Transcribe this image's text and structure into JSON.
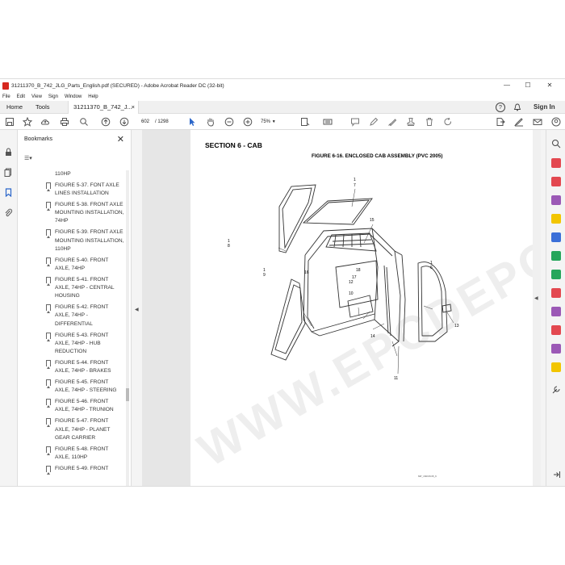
{
  "window": {
    "title": "31211370_B_742_JLG_Parts_English.pdf (SECURED) - Adobe Acrobat Reader DC (32-bit)",
    "minimize": "—",
    "maximize": "☐",
    "close": "✕"
  },
  "menu": [
    "File",
    "Edit",
    "View",
    "Sign",
    "Window",
    "Help"
  ],
  "tabs": {
    "home": "Home",
    "tools": "Tools",
    "document": "31211370_B_742_J...",
    "close": "×",
    "help": "?",
    "bell": "🔔",
    "sign_in": "Sign In"
  },
  "toolbar": {
    "page_current": "602",
    "page_total": "/ 1298",
    "zoom": "75%"
  },
  "bookmarks": {
    "title": "Bookmarks",
    "close": "✕",
    "options": "☰▾",
    "items": [
      "110HP",
      "FIGURE 5-37. FONT AXLE LINES INSTALLATION",
      "FIGURE 5-38. FRONT AXLE MOUNTING INSTALLATION, 74HP",
      "FIGURE 5-39. FRONT AXLE MOUNTING INSTALLATION, 110HP",
      "FIGURE 5-40. FRONT AXLE, 74HP",
      "FIGURE 5-41. FRONT AXLE, 74HP - CENTRAL HOUSING",
      "FIGURE 5-42. FRONT AXLE, 74HP - DIFFERENTIAL",
      "FIGURE 5-43. FRONT AXLE, 74HP  -  HUB REDUCTION",
      "FIGURE 5-44. FRONT AXLE, 74HP - BRAKES",
      "FIGURE 5-45. FRONT AXLE, 74HP - STEERING",
      "FIGURE 5-46. FRONT AXLE, 74HP  - TRUNION",
      "FIGURE 5-47. FRONT AXLE, 74HP - PLANET GEAR CARRIER",
      "FIGURE 5-48. FRONT AXLE, 110HP",
      "FIGURE 5-49. FRONT"
    ]
  },
  "document": {
    "section_title": "SECTION 6 - CAB",
    "figure_title": "FIGURE 6-16. ENCLOSED CAB ASSEMBLY (PVC 2005)",
    "watermark": "WWW.EPCDEPO.COM",
    "drawing_code": "MP_160/15/45_6",
    "callouts": [
      "1",
      "7",
      "15",
      "1",
      "8",
      "1",
      "9",
      "1",
      "6",
      "16",
      "18",
      "17",
      "12",
      "10",
      "14",
      "13",
      "11"
    ]
  }
}
